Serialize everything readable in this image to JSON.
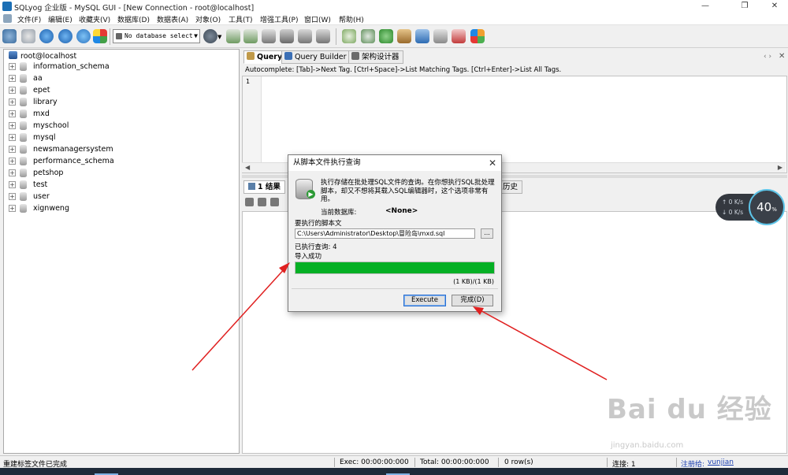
{
  "window": {
    "title": "SQLyog 企业版 - MySQL GUI - [New Connection - root@localhost]",
    "controls": [
      "—",
      "❐",
      "✕"
    ]
  },
  "menu": [
    "文件(F)",
    "编辑(E)",
    "收藏夹(V)",
    "数据库(D)",
    "数据表(A)",
    "对象(O)",
    "工具(T)",
    "增强工具(P)",
    "窗口(W)",
    "帮助(H)"
  ],
  "toolbar": {
    "db_select_value": "No database select"
  },
  "tree": {
    "root": "root@localhost",
    "databases": [
      "information_schema",
      "aa",
      "epet",
      "library",
      "mxd",
      "myschool",
      "mysql",
      "newsmanagersystem",
      "performance_schema",
      "petshop",
      "test",
      "user",
      "xignweng"
    ]
  },
  "tabs": [
    {
      "label": "Query",
      "active": true
    },
    {
      "label": "Query Builder",
      "active": false
    },
    {
      "label": "架构设计器",
      "active": false
    }
  ],
  "autocomplete_hint": "Autocomplete: [Tab]->Next Tag. [Ctrl+Space]->List Matching Tags. [Ctrl+Enter]->List All Tags.",
  "editor": {
    "line_number": "1"
  },
  "result_tabs": [
    {
      "label": "1 结果",
      "active": true
    },
    {
      "label": "历史",
      "active": false
    }
  ],
  "dialog": {
    "title": "从脚本文件执行查询",
    "close": "✕",
    "description": "执行存储在批处理SQL文件的查询。在你想执行SQL批处理脚本，却又不想将其载入SQL编辑器时，这个选项非常有用。",
    "current_db_label": "当前数据库:",
    "current_db_value": "<None>",
    "file_label": "要执行的脚本文",
    "file_path": "C:\\Users\\Administrator\\Desktop\\冒险岛\\mxd.sql",
    "browse": "...",
    "executed_text": "已执行查询: 4",
    "success_text": "导入成功",
    "progress": 1.0,
    "progress_color": "#06b025",
    "size_text": "(1 KB)/(1 KB)",
    "execute_button": "Execute",
    "done_button": "完成(D)"
  },
  "status": {
    "message": "重建标签文件已完成",
    "exec": "Exec: 00:00:00:000",
    "total": "Total: 00:00:00:000",
    "rows": "0 row(s)",
    "conn": "连接: 1",
    "reg_label": "注册给:",
    "reg_user": "vunjian"
  },
  "speed_widget": {
    "up": "0 K/s",
    "down": "0 K/s",
    "gauge": "40",
    "gauge_unit": "%"
  },
  "watermark": {
    "brand": "Bai du 经验",
    "url": "jingyan.baidu.com"
  }
}
